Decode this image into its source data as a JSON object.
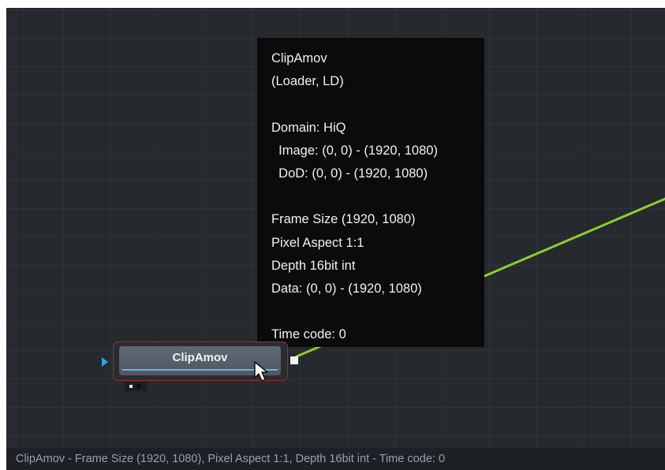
{
  "tooltip": {
    "lines": [
      "ClipAmov",
      "(Loader, LD)",
      "",
      "Domain: HiQ",
      "  Image: (0, 0) - (1920, 1080)",
      "  DoD: (0, 0) - (1920, 1080)",
      "",
      "Frame Size (1920, 1080)",
      "Pixel Aspect 1:1",
      "Depth 16bit int",
      "Data: (0, 0) - (1920, 1080)",
      "",
      "Time code: 0"
    ]
  },
  "node": {
    "title": "ClipAmov"
  },
  "status_bar": {
    "text": "ClipAmov - Frame Size (1920, 1080), Pixel Aspect 1:1, Depth 16bit int - Time code: 0"
  },
  "colors": {
    "wire": "#8ccf2a",
    "input_port": "#2aa3e8",
    "node_selected_border": "#9b2f2f",
    "node_underline": "#6fb0d8"
  },
  "icons": {
    "input_port": "triangle-right-icon",
    "output_port": "square-icon",
    "cursor": "mouse-pointer-icon",
    "view_indicator": "view-dots-icon"
  }
}
